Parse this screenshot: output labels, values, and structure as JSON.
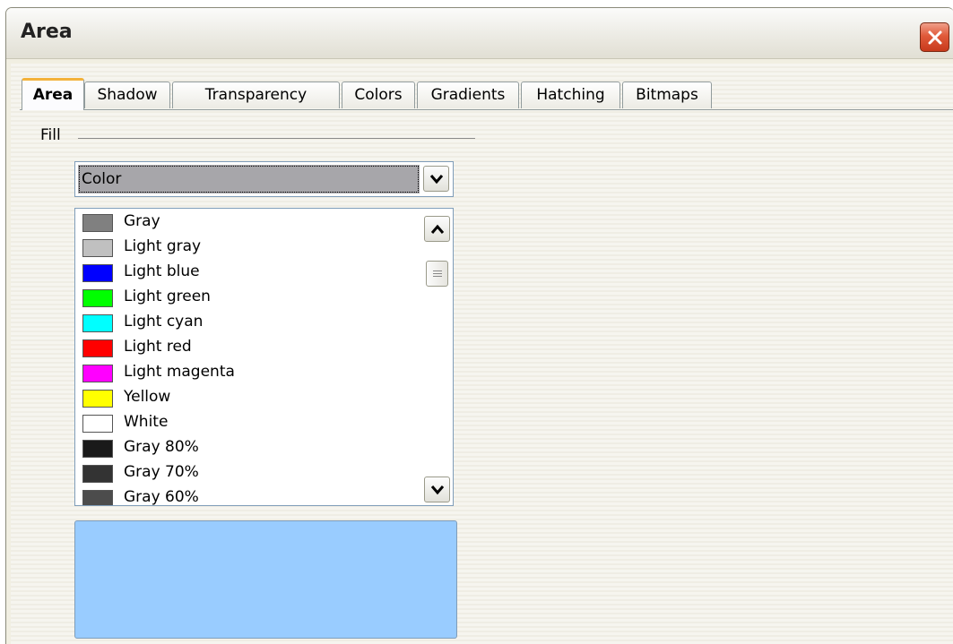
{
  "window": {
    "title": "Area"
  },
  "tabs": [
    {
      "label": "Area",
      "active": true
    },
    {
      "label": "Shadow",
      "active": false
    },
    {
      "label": "Transparency",
      "active": false
    },
    {
      "label": "Colors",
      "active": false
    },
    {
      "label": "Gradients",
      "active": false
    },
    {
      "label": "Hatching",
      "active": false
    },
    {
      "label": "Bitmaps",
      "active": false
    }
  ],
  "fill": {
    "section_label": "Fill",
    "type_selected": "Color"
  },
  "color_list": [
    {
      "label": "Gray",
      "color": "#808080"
    },
    {
      "label": "Light gray",
      "color": "#c0c0c0"
    },
    {
      "label": "Light blue",
      "color": "#0000ff"
    },
    {
      "label": "Light green",
      "color": "#00ff00"
    },
    {
      "label": "Light cyan",
      "color": "#00ffff"
    },
    {
      "label": "Light red",
      "color": "#ff0000"
    },
    {
      "label": "Light magenta",
      "color": "#ff00ff"
    },
    {
      "label": "Yellow",
      "color": "#ffff00"
    },
    {
      "label": "White",
      "color": "#ffffff"
    },
    {
      "label": "Gray 80%",
      "color": "#1a1a1a"
    },
    {
      "label": "Gray 70%",
      "color": "#333333"
    },
    {
      "label": "Gray 60%",
      "color": "#4c4c4c"
    }
  ],
  "preview": {
    "color": "#99ccff"
  },
  "icons": {
    "close": "close-icon",
    "dropdown": "chevron-down-icon",
    "scroll_up": "chevron-up-icon",
    "scroll_down": "chevron-down-icon",
    "thumb_grip": "grip-icon"
  }
}
